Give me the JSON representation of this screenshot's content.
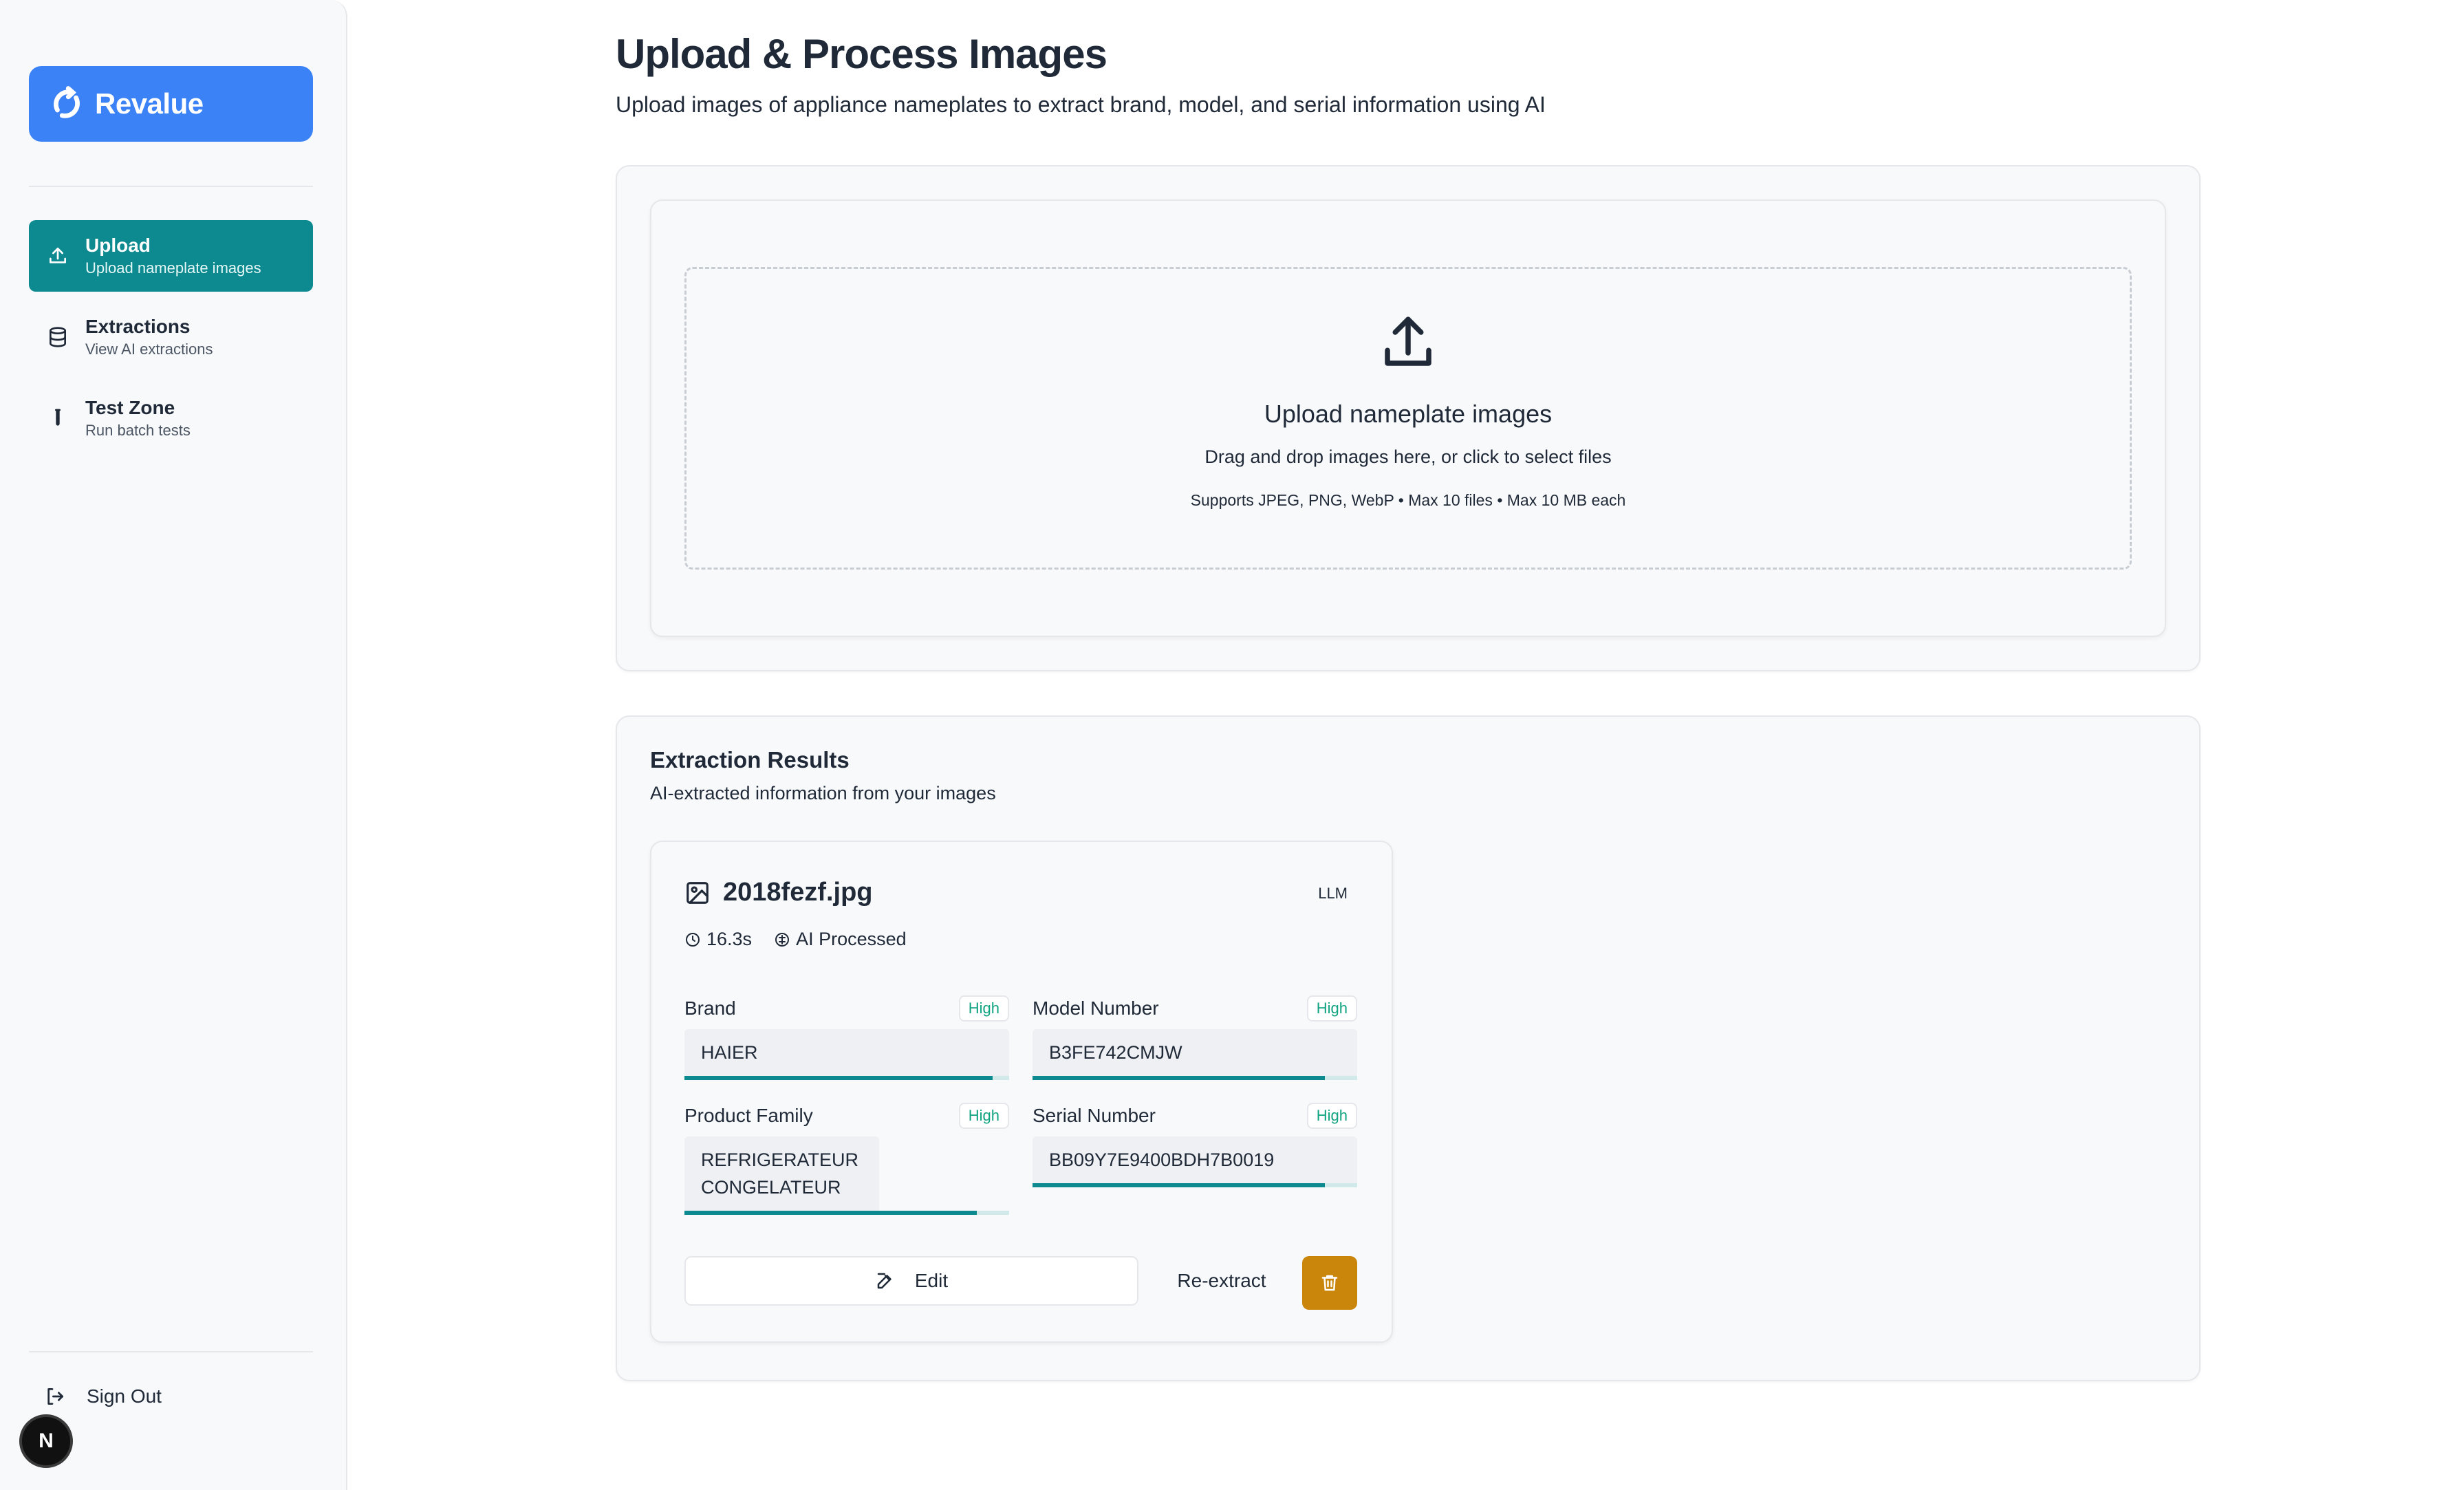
{
  "sidebar": {
    "brand": "Revalue",
    "items": [
      {
        "label": "Upload",
        "sub": "Upload nameplate images",
        "icon": "upload-icon",
        "active": true
      },
      {
        "label": "Extractions",
        "sub": "View AI extractions",
        "icon": "database-icon",
        "active": false
      },
      {
        "label": "Test Zone",
        "sub": "Run batch tests",
        "icon": "test-tube-icon",
        "active": false
      }
    ],
    "signout_label": "Sign Out",
    "avatar_letter": "N"
  },
  "header": {
    "title": "Upload & Process Images",
    "subtitle": "Upload images of appliance nameplates to extract brand, model, and serial information using AI"
  },
  "upload": {
    "title": "Upload nameplate images",
    "description": "Drag and drop images here, or click to select files",
    "support": "Supports JPEG, PNG, WebP • Max 10 files • Max 10 MB each"
  },
  "results": {
    "title": "Extraction Results",
    "subtitle": "AI-extracted information from your images",
    "card": {
      "filename": "2018fezf.jpg",
      "source_tag": "LLM",
      "time": "16.3s",
      "status": "AI Processed",
      "fields": [
        {
          "label": "Brand",
          "value": "HAIER",
          "confidence": "High",
          "confidence_fraction": 0.95
        },
        {
          "label": "Model Number",
          "value": "B3FE742CMJW",
          "confidence": "High",
          "confidence_fraction": 0.9
        },
        {
          "label": "Product Family",
          "value": "REFRIGERATEUR CONGELATEUR",
          "confidence": "High",
          "confidence_fraction": 0.9
        },
        {
          "label": "Serial Number",
          "value": "BB09Y7E9400BDH7B0019",
          "confidence": "High",
          "confidence_fraction": 0.9
        }
      ],
      "edit_label": "Edit",
      "reextract_label": "Re-extract"
    }
  },
  "colors": {
    "brand_blue": "#3b82f6",
    "active_teal": "#0d8a8f",
    "badge_green": "#10a37f",
    "delete_amber": "#c9860b"
  }
}
